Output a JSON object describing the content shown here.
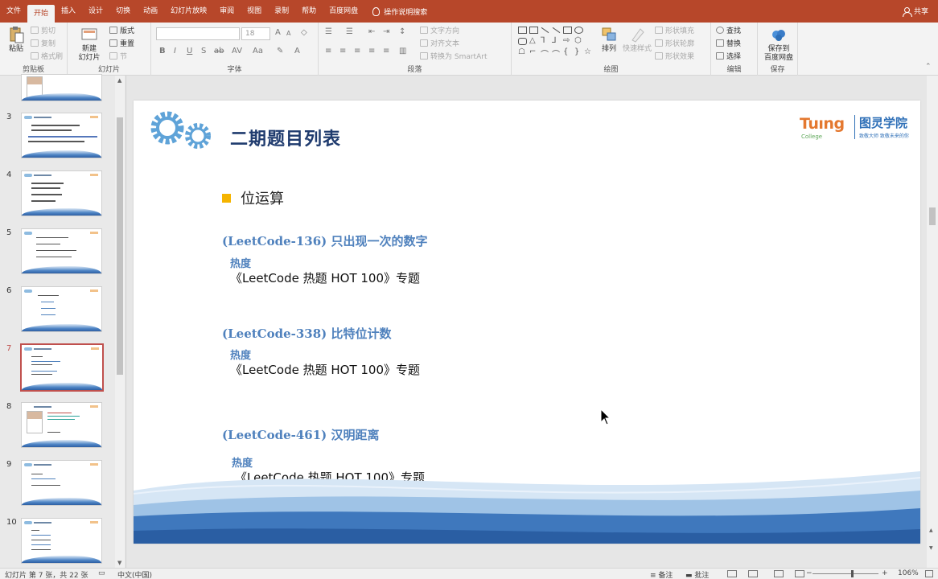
{
  "tabs": [
    "文件",
    "开始",
    "插入",
    "设计",
    "切换",
    "动画",
    "幻灯片放映",
    "审阅",
    "视图",
    "录制",
    "帮助",
    "百度网盘"
  ],
  "active_tab_index": 1,
  "tell_me": "操作说明搜索",
  "share": "共享",
  "ribbon": {
    "clipboard": {
      "paste": "粘贴",
      "cut": "剪切",
      "copy": "复制",
      "format_painter": "格式刷",
      "label": "剪贴板"
    },
    "slides": {
      "new_slide_1": "新建",
      "new_slide_2": "幻灯片",
      "layout": "版式",
      "reset": "重置",
      "section": "节",
      "label": "幻灯片"
    },
    "font": {
      "size": "18",
      "label": "字体",
      "b": "B",
      "i": "I",
      "u": "U",
      "s": "S",
      "ab": "ab",
      "av": "AV",
      "aa": "Aa",
      "a": "A",
      "grow": "A",
      "shrink": "A"
    },
    "paragraph": {
      "text_direction": "文字方向",
      "align_text": "对齐文本",
      "smartart": "转换为 SmartArt",
      "label": "段落"
    },
    "drawing": {
      "arrange": "排列",
      "quick_styles": "快速样式",
      "shape_fill": "形状填充",
      "shape_outline": "形状轮廓",
      "shape_effects": "形状效果",
      "label": "绘图"
    },
    "editing": {
      "find": "查找",
      "replace": "替换",
      "select": "选择",
      "label": "编辑"
    },
    "save": {
      "line1": "保存到",
      "line2": "百度网盘",
      "label": "保存"
    }
  },
  "slide_numbers": [
    "3",
    "4",
    "5",
    "6",
    "7",
    "8",
    "9",
    "10"
  ],
  "current_slide_index": 4,
  "slide": {
    "title": "二期题目列表",
    "section": "位运算",
    "questions": [
      {
        "title": "(LeetCode-136) 只出现一次的数字",
        "heat": "热度",
        "topic": "《LeetCode 热题 HOT 100》专题"
      },
      {
        "title": "(LeetCode-338) 比特位计数",
        "heat": "热度",
        "topic": "《LeetCode 热题 HOT 100》专题"
      },
      {
        "title": "(LeetCode-461) 汉明距离",
        "heat": "热度",
        "topic": "《LeetCode 热题 HOT 100》专题"
      }
    ],
    "brand": {
      "en": "Tuıng",
      "college": "College",
      "cn": "图灵学院",
      "tagline": "致敬大师 致敬未来的你"
    }
  },
  "status": {
    "slide_info": "幻灯片 第 7 张，共 22 张",
    "language": "中文(中国)",
    "notes": "备注",
    "comments": "批注",
    "zoom": "106%"
  },
  "colors": {
    "accent": "#b7472a",
    "title": "#1f3b6e",
    "question": "#4f81bd",
    "bullet": "#f5b400"
  }
}
